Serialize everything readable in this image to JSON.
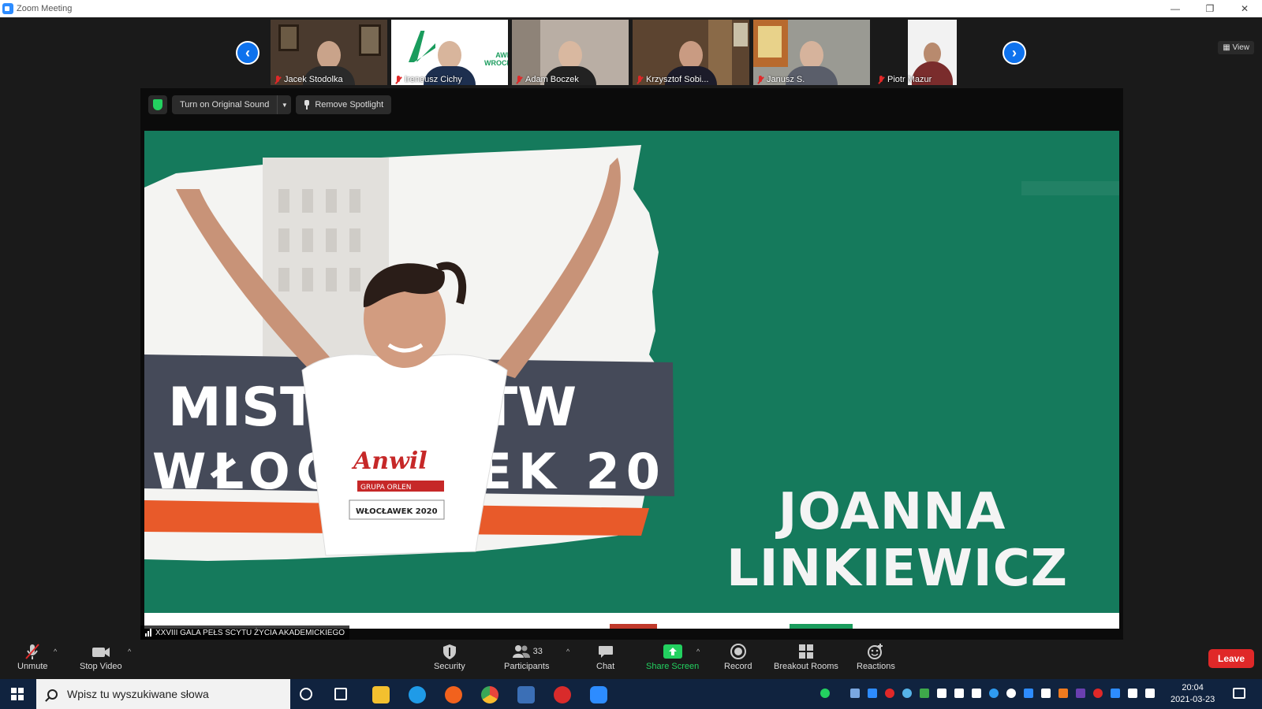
{
  "window": {
    "title": "Zoom Meeting",
    "controls": [
      "—",
      "❐",
      "✕"
    ]
  },
  "thumbnails": [
    {
      "name": "Jacek Stodolka",
      "bg": "#4a3a2e",
      "skin": "#c9a38a",
      "suit": "#2a2a2a"
    },
    {
      "name": "Ireneusz Cichy",
      "bg": "#ffffff",
      "skin": "#d8b59c",
      "suit": "#1d2f4f",
      "logo_left": "AWF",
      "logo_right": "WROCŁAW"
    },
    {
      "name": "Adam Boczek",
      "bg": "#b9aea4",
      "skin": "#d9b8a0",
      "suit": "#222"
    },
    {
      "name": "Krzysztof Sobi...",
      "bg": "#5c4430",
      "skin": "#c99b82",
      "suit": "#1c1c2a"
    },
    {
      "name": "Janusz S.",
      "bg": "#9a9a93",
      "skin": "#d6b39c",
      "suit": "#5a5e6a"
    },
    {
      "name": "Piotr Mazur",
      "bg": "#f2f2f2",
      "skin": "#b88a6e",
      "suit": "#7a2c2c"
    }
  ],
  "view_label": "View",
  "stage": {
    "original_sound": "Turn on Original Sound",
    "remove_spotlight": "Remove Spotlight",
    "speaker": "XXVIII GALA PEŁS SCYTU ŻYCIA AKADEMICKIEGO"
  },
  "slide": {
    "name_line1": "JOANNA",
    "name_line2": "LINKIEWICZ",
    "banner_top": "MISTRZOSTW",
    "banner_bottom": "WŁOCŁAWEK 20",
    "shirt_brand": "Anwil",
    "shirt_group": "GRUPA ORLEN",
    "bib": "WŁOCŁAWEK 2020",
    "bg_color": "#157a5c"
  },
  "controls": {
    "unmute": "Unmute",
    "stop_video": "Stop Video",
    "security": "Security",
    "participants": "Participants",
    "participants_count": "33",
    "chat": "Chat",
    "share_screen": "Share Screen",
    "record": "Record",
    "breakout": "Breakout Rooms",
    "reactions": "Reactions",
    "leave": "Leave"
  },
  "taskbar": {
    "search_placeholder": "Wpisz tu wyszukiwane słowa",
    "time": "20:04",
    "date": "2021-03-23"
  }
}
